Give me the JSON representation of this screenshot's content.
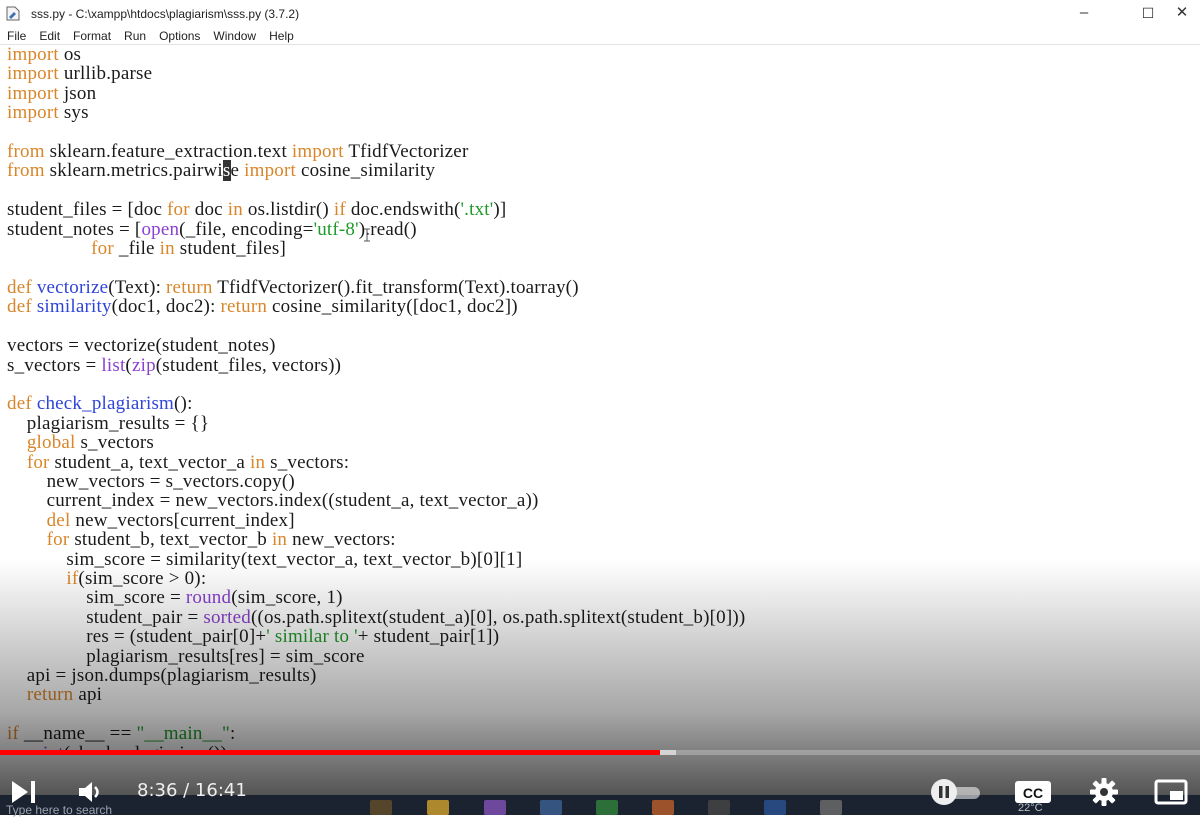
{
  "window": {
    "title": "sss.py - C:\\xampp\\htdocs\\plagiarism\\sss.py (3.7.2)",
    "buttons": [
      "–",
      "☐",
      "✕"
    ]
  },
  "menu": [
    "File",
    "Edit",
    "Format",
    "Run",
    "Options",
    "Window",
    "Help"
  ],
  "code_lines": [
    [
      [
        "kw",
        "import"
      ],
      [
        "",
        " os"
      ]
    ],
    [
      [
        "kw",
        "import"
      ],
      [
        "",
        " urllib.parse"
      ]
    ],
    [
      [
        "kw",
        "import"
      ],
      [
        "",
        " json"
      ]
    ],
    [
      [
        "kw",
        "import"
      ],
      [
        "",
        " sys"
      ]
    ],
    [],
    [
      [
        "kw",
        "from"
      ],
      [
        "",
        " sklearn.feature_extraction.text "
      ],
      [
        "kw",
        "import"
      ],
      [
        "",
        " TfidfVectorizer"
      ]
    ],
    [
      [
        "kw",
        "from"
      ],
      [
        "",
        " sklearn.metrics.pairwi"
      ],
      [
        "cursor",
        "s"
      ],
      [
        "",
        "e "
      ],
      [
        "kw",
        "import"
      ],
      [
        "",
        " cosine_similarity"
      ]
    ],
    [],
    [
      [
        "",
        "student_files = [doc "
      ],
      [
        "kw",
        "for"
      ],
      [
        "",
        " doc "
      ],
      [
        "kw",
        "in"
      ],
      [
        "",
        " os.listdir() "
      ],
      [
        "kw",
        "if"
      ],
      [
        "",
        " doc.endswith("
      ],
      [
        "st",
        "'.txt'"
      ],
      [
        "",
        ")]"
      ]
    ],
    [
      [
        "",
        "student_notes = ["
      ],
      [
        "bi",
        "open"
      ],
      [
        "",
        "(_file, encoding="
      ],
      [
        "st",
        "'utf-8'"
      ],
      [
        "",
        ").read()"
      ]
    ],
    [
      [
        "",
        "                 "
      ],
      [
        "kw",
        "for"
      ],
      [
        "",
        " _file "
      ],
      [
        "kw",
        "in"
      ],
      [
        "",
        " student_files]"
      ]
    ],
    [],
    [
      [
        "kw",
        "def"
      ],
      [
        "",
        " "
      ],
      [
        "fn",
        "vectorize"
      ],
      [
        "",
        "(Text): "
      ],
      [
        "kw",
        "return"
      ],
      [
        "",
        " TfidfVectorizer().fit_transform(Text).toarray()"
      ]
    ],
    [
      [
        "kw",
        "def"
      ],
      [
        "",
        " "
      ],
      [
        "fn",
        "similarity"
      ],
      [
        "",
        "(doc1, doc2): "
      ],
      [
        "kw",
        "return"
      ],
      [
        "",
        " cosine_similarity([doc1, doc2])"
      ]
    ],
    [],
    [
      [
        "",
        "vectors = vectorize(student_notes)"
      ]
    ],
    [
      [
        "",
        "s_vectors = "
      ],
      [
        "bi",
        "list"
      ],
      [
        "",
        "("
      ],
      [
        "bi",
        "zip"
      ],
      [
        "",
        "(student_files, vectors))"
      ]
    ],
    [],
    [
      [
        "kw",
        "def"
      ],
      [
        "",
        " "
      ],
      [
        "fn",
        "check_plagiarism"
      ],
      [
        "",
        "():"
      ]
    ],
    [
      [
        "",
        "    plagiarism_results = {}"
      ]
    ],
    [
      [
        "",
        "    "
      ],
      [
        "kw",
        "global"
      ],
      [
        "",
        " s_vectors"
      ]
    ],
    [
      [
        "",
        "    "
      ],
      [
        "kw",
        "for"
      ],
      [
        "",
        " student_a, text_vector_a "
      ],
      [
        "kw",
        "in"
      ],
      [
        "",
        " s_vectors:"
      ]
    ],
    [
      [
        "",
        "        new_vectors = s_vectors.copy()"
      ]
    ],
    [
      [
        "",
        "        current_index = new_vectors.index((student_a, text_vector_a))"
      ]
    ],
    [
      [
        "",
        "        "
      ],
      [
        "kw",
        "del"
      ],
      [
        "",
        " new_vectors[current_index]"
      ]
    ],
    [
      [
        "",
        "        "
      ],
      [
        "kw",
        "for"
      ],
      [
        "",
        " student_b, text_vector_b "
      ],
      [
        "kw",
        "in"
      ],
      [
        "",
        " new_vectors:"
      ]
    ],
    [
      [
        "",
        "            sim_score = similarity(text_vector_a, text_vector_b)[0][1]"
      ]
    ],
    [
      [
        "",
        "            "
      ],
      [
        "kw",
        "if"
      ],
      [
        "",
        "(sim_score > 0):"
      ]
    ],
    [
      [
        "",
        "                sim_score = "
      ],
      [
        "bi",
        "round"
      ],
      [
        "",
        "(sim_score, 1)"
      ]
    ],
    [
      [
        "",
        "                student_pair = "
      ],
      [
        "bi",
        "sorted"
      ],
      [
        "",
        "((os.path.splitext(student_a)[0], os.path.splitext(student_b)[0]))"
      ]
    ],
    [
      [
        "",
        "                res = (student_pair[0]+"
      ],
      [
        "st",
        "' similar to '"
      ],
      [
        "",
        "+ student_pair[1])"
      ]
    ],
    [
      [
        "",
        "                plagiarism_results[res] = sim_score"
      ]
    ],
    [
      [
        "",
        "    api = json.dumps(plagiarism_results)"
      ]
    ],
    [
      [
        "",
        "    "
      ],
      [
        "kw",
        "return"
      ],
      [
        "",
        " api"
      ]
    ],
    [],
    [
      [
        "kw",
        "if"
      ],
      [
        "",
        " __name__ == "
      ],
      [
        "st",
        "\"__main__\""
      ],
      [
        "",
        ":"
      ]
    ],
    [
      [
        "",
        "    "
      ],
      [
        "bi",
        "print"
      ],
      [
        "",
        "(check_plagiarism())"
      ]
    ]
  ],
  "colors": {
    "keyword": "#d9862a",
    "builtin": "#8a3fd0",
    "function_def": "#2f44d8",
    "string": "#1e9a2a",
    "progress_played": "#ff0000"
  },
  "video": {
    "time_current": "8:36",
    "time_total": "16:41",
    "time_display": "8:36 / 16:41",
    "played_fraction": 0.55,
    "buffered_fraction": 0.563,
    "cc_label": "CC",
    "icons": [
      "next-icon",
      "volume-icon",
      "pause-autoplay-icon",
      "cc-icon",
      "settings-gear-icon",
      "miniplayer-icon"
    ]
  },
  "taskbar": {
    "search_placeholder": "Type here to search",
    "temperature": "22°C"
  }
}
